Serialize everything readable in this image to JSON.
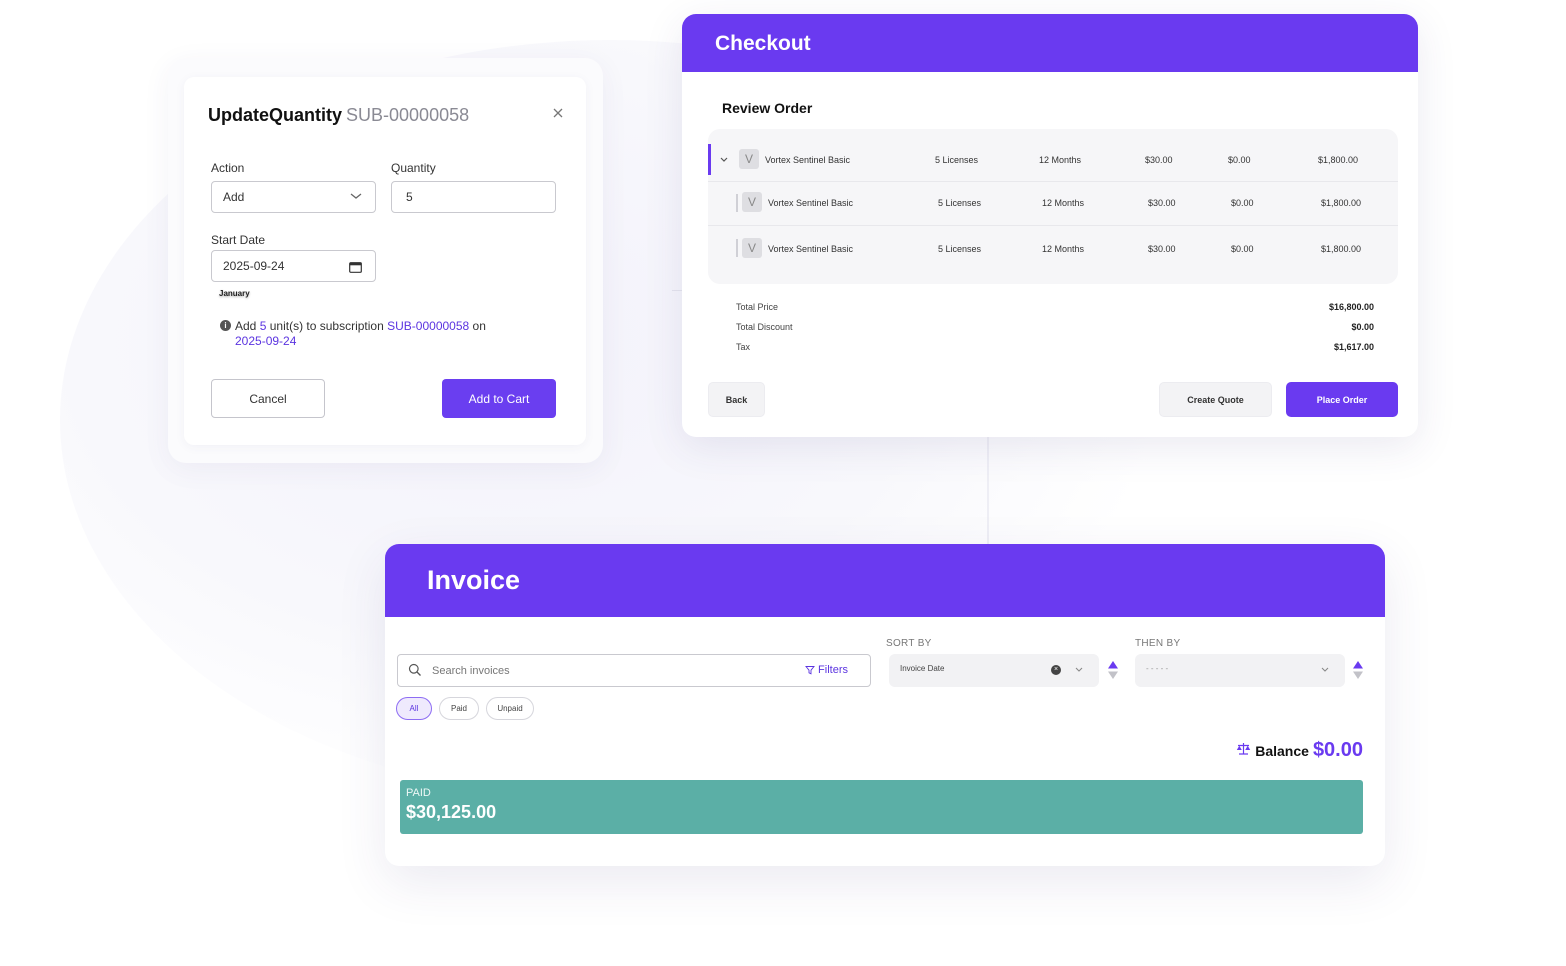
{
  "update_quantity": {
    "title": "UpdateQuantity",
    "subscription_id": "SUB-00000058",
    "action_label": "Action",
    "action_value": "Add",
    "quantity_label": "Quantity",
    "quantity_value": "5",
    "start_date_label": "Start Date",
    "start_date_value": "2025-09-24",
    "tooltip_month": "January",
    "info": {
      "prefix": "Add",
      "qty": "5",
      "middle": "unit(s) to subscription",
      "sub": "SUB-00000058",
      "on": "on",
      "date": "2025-09-24"
    },
    "cancel_label": "Cancel",
    "add_label": "Add to Cart"
  },
  "checkout": {
    "title": "Checkout",
    "review_label": "Review Order",
    "rows": [
      {
        "initial": "V",
        "product": "Vortex Sentinel Basic",
        "licenses": "5 Licenses",
        "term": "12 Months",
        "price": "$30.00",
        "discount": "$0.00",
        "total": "$1,800.00"
      },
      {
        "initial": "V",
        "product": "Vortex Sentinel Basic",
        "licenses": "5 Licenses",
        "term": "12 Months",
        "price": "$30.00",
        "discount": "$0.00",
        "total": "$1,800.00"
      },
      {
        "initial": "V",
        "product": "Vortex Sentinel Basic",
        "licenses": "5 Licenses",
        "term": "12 Months",
        "price": "$30.00",
        "discount": "$0.00",
        "total": "$1,800.00"
      }
    ],
    "totals": [
      {
        "label": "Total Price",
        "value": "$16,800.00"
      },
      {
        "label": "Total Discount",
        "value": "$0.00"
      },
      {
        "label": "Tax",
        "value": "$1,617.00"
      }
    ],
    "back_label": "Back",
    "quote_label": "Create Quote",
    "place_label": "Place Order"
  },
  "invoice": {
    "title": "Invoice",
    "search_placeholder": "Search invoices",
    "filters_label": "Filters",
    "pills": [
      "All",
      "Paid",
      "Unpaid"
    ],
    "sort_by_label": "SORT BY",
    "sort_by_value": "Invoice Date",
    "then_by_label": "THEN BY",
    "then_by_value": "- - - - -",
    "balance_label": "Balance",
    "balance_value": "$0.00",
    "paid_label": "PAID",
    "paid_amount": "$30,125.00"
  },
  "colors": {
    "accent": "#6a3af0",
    "paid_bar": "#5bafa6"
  },
  "icons": [
    "close-icon",
    "chevron-down-icon",
    "calendar-icon",
    "info-icon",
    "search-icon",
    "filter-icon",
    "clear-icon",
    "sort-arrows-icon",
    "balance-scale-icon"
  ]
}
